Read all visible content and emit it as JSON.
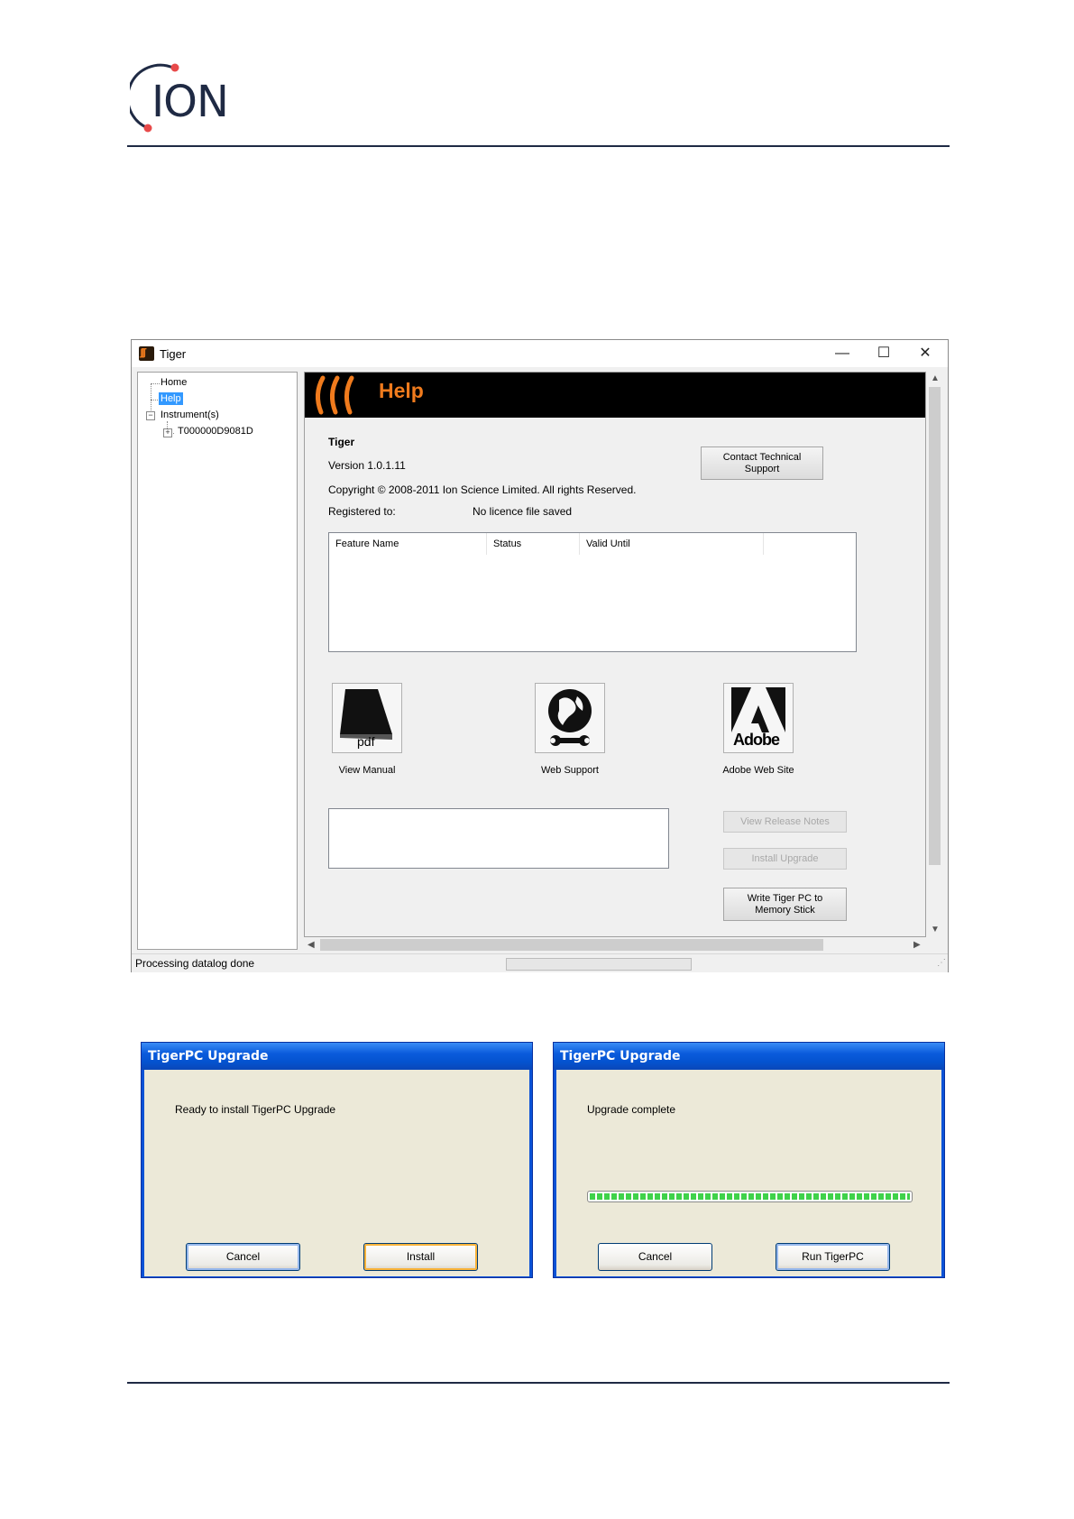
{
  "header": {
    "logo_text": "ION"
  },
  "tiger_window": {
    "title": "Tiger",
    "controls": {
      "minimize": "—",
      "maximize": "☐",
      "close": "✕"
    },
    "tree": {
      "items": [
        {
          "label": "Home"
        },
        {
          "label": "Help",
          "selected": true
        },
        {
          "label": "Instrument(s)"
        },
        {
          "label": "T000000D9081D"
        }
      ]
    },
    "banner_title": "Help",
    "product_name": "Tiger",
    "version": "Version 1.0.1.11",
    "copyright": "Copyright © 2008-2011 Ion Science Limited. All rights Reserved.",
    "registered_label": "Registered to:",
    "registered_value": "No licence file saved",
    "contact_button": "Contact Technical Support",
    "table": {
      "columns": [
        "Feature Name",
        "Status",
        "Valid Until"
      ],
      "rows": []
    },
    "icons": [
      {
        "name": "pdf-icon",
        "glyph_text": "pdf",
        "label": "View Manual"
      },
      {
        "name": "globe-wrench-icon",
        "label": "Web Support"
      },
      {
        "name": "adobe-icon",
        "glyph_text": "Adobe",
        "label": "Adobe Web Site"
      }
    ],
    "buttons": {
      "view_release_notes": "View Release Notes",
      "install_upgrade": "Install Upgrade",
      "write_memory_stick": "Write Tiger PC to Memory Stick"
    },
    "status_text": "Processing datalog done",
    "accent_color": "#f07b1d"
  },
  "dialogs": [
    {
      "title": "TigerPC Upgrade",
      "message": "Ready to install TigerPC Upgrade",
      "cancel": "Cancel",
      "primary": "Install"
    },
    {
      "title": "TigerPC Upgrade",
      "message": "Upgrade complete",
      "progress": 1.0,
      "cancel": "Cancel",
      "primary": "Run TigerPC"
    }
  ]
}
